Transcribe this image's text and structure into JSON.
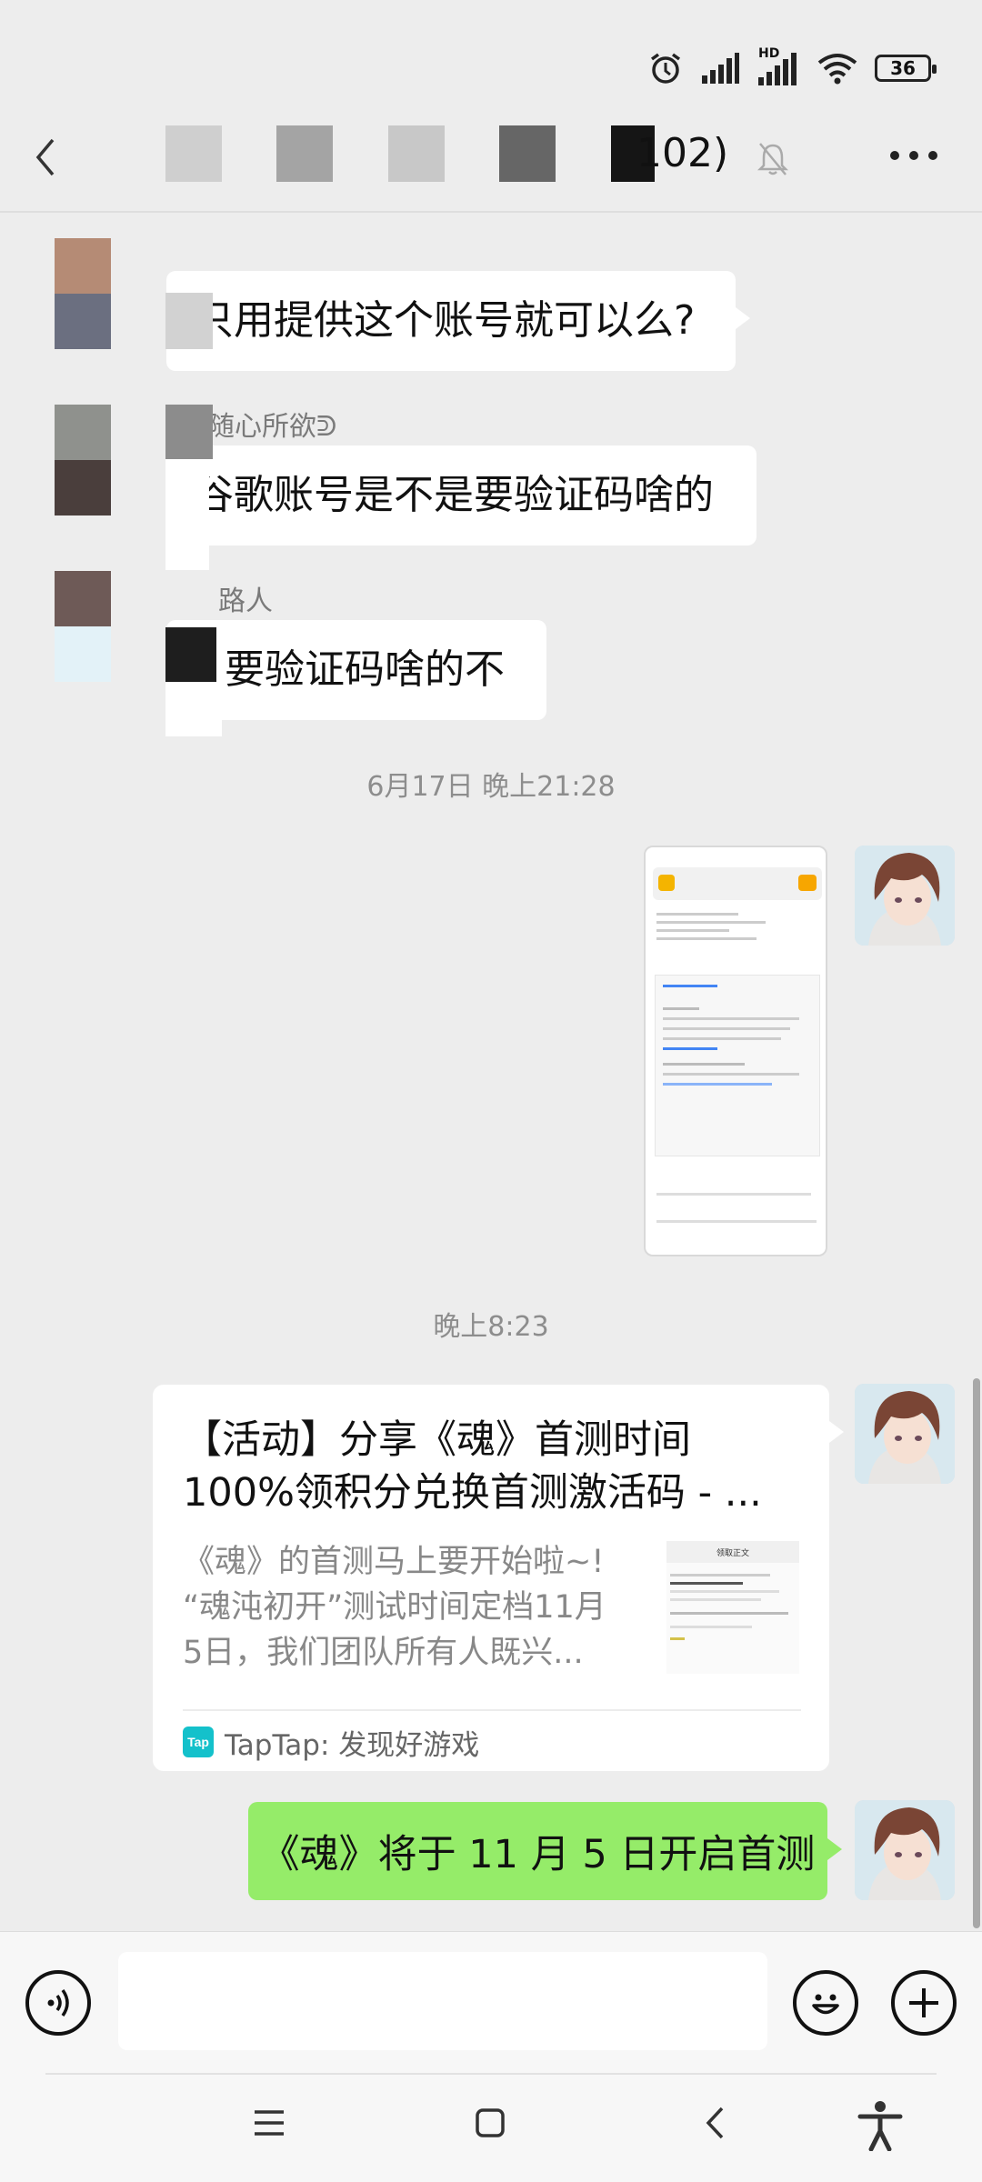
{
  "status_bar": {
    "battery": "36",
    "network_label": "HD"
  },
  "header": {
    "group_count": "102)"
  },
  "messages": [
    {
      "text": "只用提供这个账号就可以么?"
    },
    {
      "sender": "随心所欲ᕲ",
      "text": "谷歌账号是不是要验证码啥的"
    },
    {
      "sender": "路人",
      "text": "要验证码啥的不"
    }
  ],
  "timestamps": {
    "first": "6月17日 晚上21:28",
    "second": "晚上8:23"
  },
  "link_card": {
    "title_line1": "【活动】分享《魂》首测时间",
    "title_line2": "100%领积分兑换首测激活码 - ...",
    "desc_line1": "《魂》的首测马上要开始啦~!",
    "desc_line2": "“魂沌初开”测试时间定档11月",
    "desc_line3": "5日，我们团队所有人既兴...",
    "thumb_label": "领取正文",
    "source": "TapTap: 发现好游戏",
    "source_logo": "Tap"
  },
  "my_text_message": "《魂》将于 11 月 5 日开启首测",
  "input": {
    "placeholder": ""
  },
  "icons": [
    "back-icon",
    "mute-bell-icon",
    "more-icon",
    "voice-icon",
    "emoji-icon",
    "plus-icon",
    "menu-nav-icon",
    "home-nav-icon",
    "back-nav-icon",
    "accessibility-icon"
  ]
}
